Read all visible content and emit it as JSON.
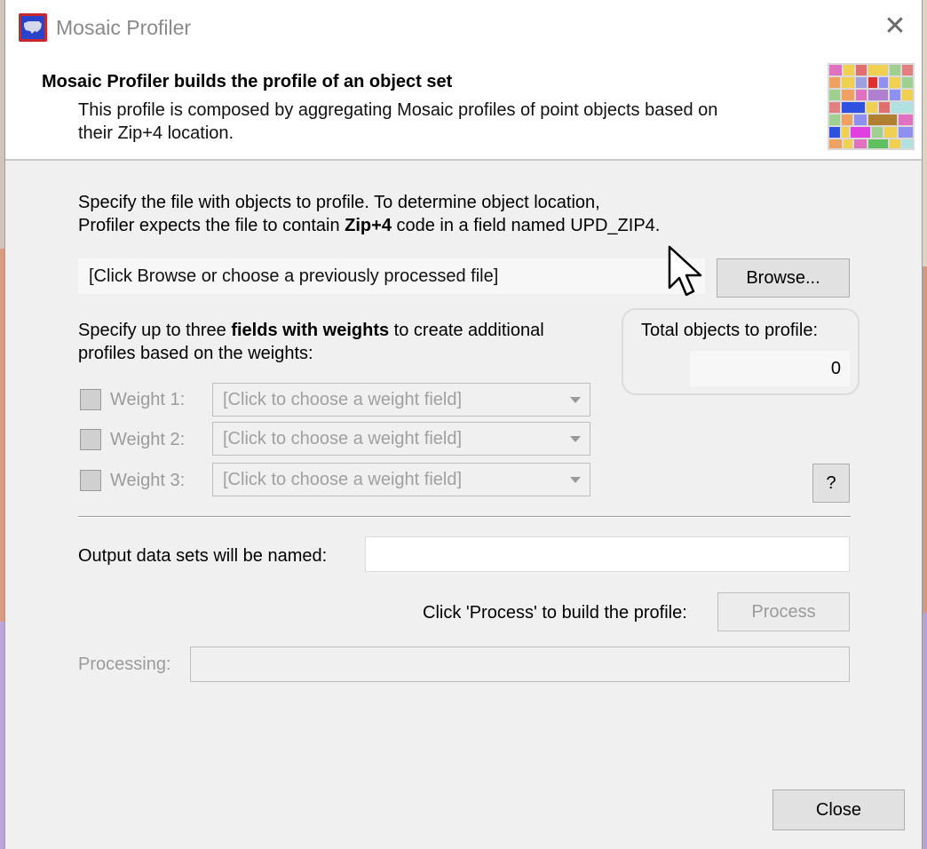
{
  "window": {
    "title": "Mosaic Profiler",
    "close_glyph": "✕"
  },
  "header": {
    "title": "Mosaic Profiler builds the profile of an object set",
    "description_line1": "This profile is composed by aggregating Mosaic profiles of point objects based on",
    "description_line2": "their Zip+4 location."
  },
  "file_section": {
    "instruction_line1": "Specify the file with objects to profile. To determine object location,",
    "instruction_line2_pre": "Profiler expects the file to contain ",
    "instruction_line2_bold": "Zip+4",
    "instruction_line2_post": " code in a field named UPD_ZIP4.",
    "file_placeholder": "[Click Browse or choose a previously processed file]",
    "browse_button": "Browse..."
  },
  "weights_section": {
    "instruction_line1_pre": "Specify up to three ",
    "instruction_line1_bold": "fields with weights",
    "instruction_line1_post": " to create additional",
    "instruction_line2": "profiles based on the weights:",
    "weights": [
      {
        "label": "Weight 1:",
        "placeholder": "[Click to choose a weight field]",
        "checked": false
      },
      {
        "label": "Weight 2:",
        "placeholder": "[Click to choose a weight field]",
        "checked": false
      },
      {
        "label": "Weight 3:",
        "placeholder": "[Click to choose a weight field]",
        "checked": false
      }
    ],
    "help_button": "?"
  },
  "total": {
    "label": "Total objects to profile:",
    "value": "0"
  },
  "output": {
    "label": "Output data sets will be named:",
    "value": ""
  },
  "process": {
    "instruction": "Click 'Process' to build the profile:",
    "button": "Process"
  },
  "processing": {
    "label": "Processing:",
    "value": ""
  },
  "footer": {
    "close_button": "Close"
  },
  "colors": {
    "dialog_bg": "#f0f0f0",
    "header_bg": "#ffffff",
    "disabled_text": "#9b9b9b",
    "icon_red": "#c8272e",
    "icon_blue": "#2a44c9"
  }
}
